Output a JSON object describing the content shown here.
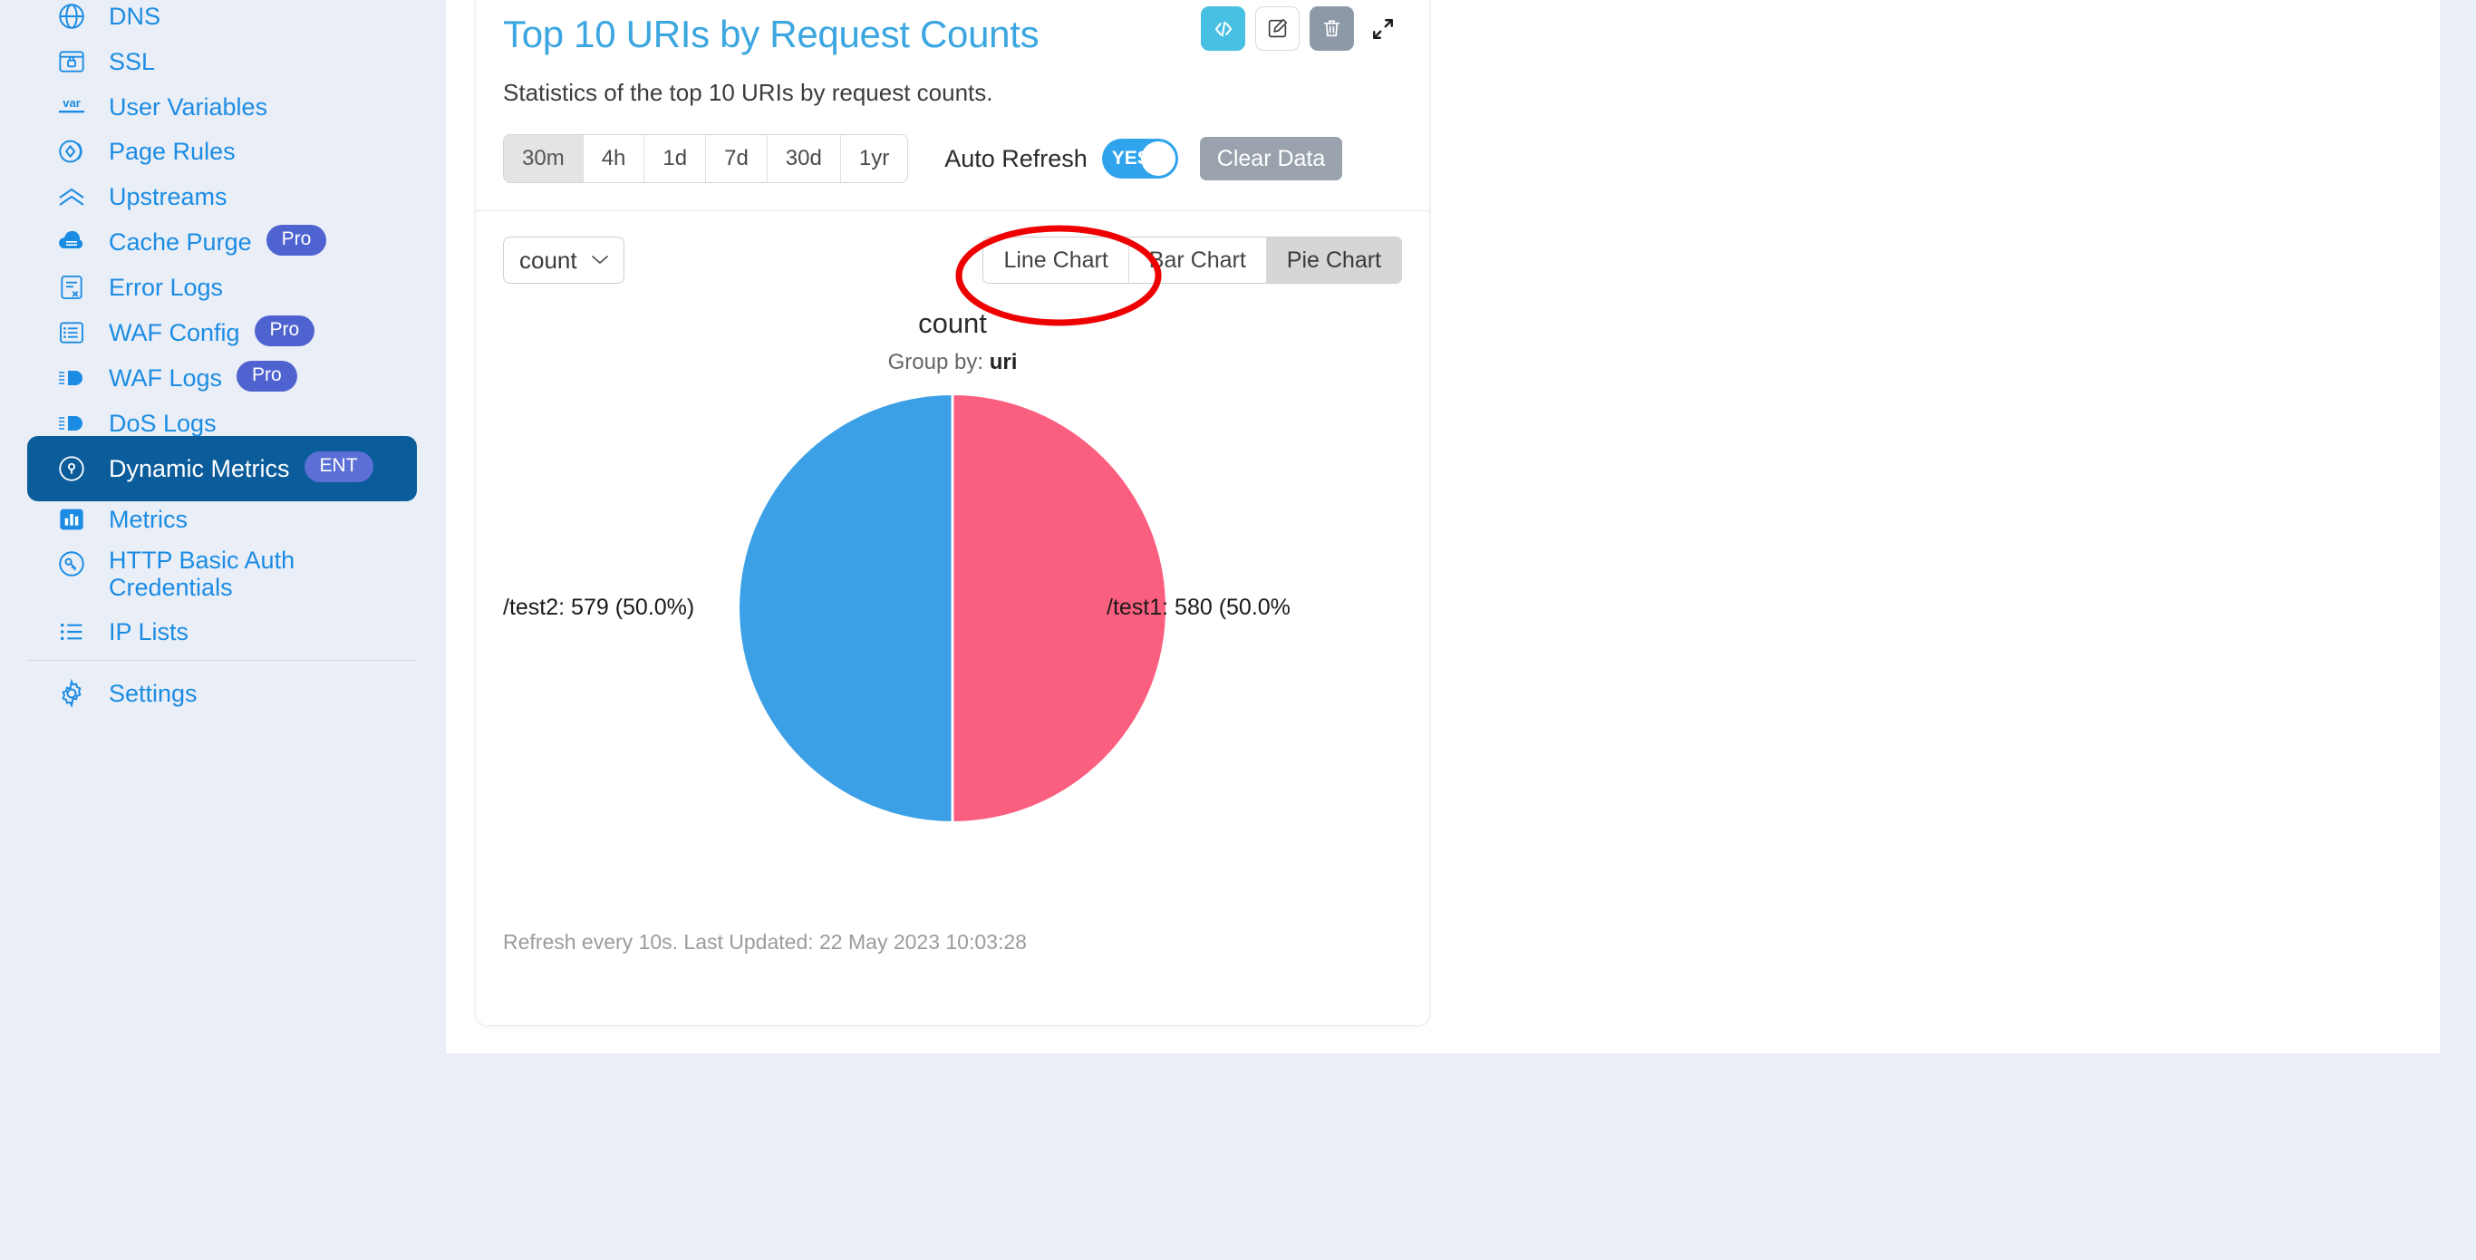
{
  "theme": {
    "accent_blue": "#1b8ce3",
    "active_nav_bg": "#0b5c9b",
    "badge_purple": "#4f63d0",
    "title_blue": "#3ba6e0",
    "annotation_red": "#ee0000",
    "pie_blue": "#3ba0e6",
    "pie_pink": "#fa5f7f"
  },
  "sidebar": {
    "items": [
      {
        "label": "DNS",
        "icon": "dns-globe-icon",
        "badge": null,
        "active": false
      },
      {
        "label": "SSL",
        "icon": "ssl-certificate-icon",
        "badge": null,
        "active": false
      },
      {
        "label": "User Variables",
        "icon": "var-icon",
        "badge": null,
        "active": false
      },
      {
        "label": "Page Rules",
        "icon": "page-rules-icon",
        "badge": null,
        "active": false
      },
      {
        "label": "Upstreams",
        "icon": "upstreams-chevron-icon",
        "badge": null,
        "active": false
      },
      {
        "label": "Cache Purge",
        "icon": "cache-purge-cloud-icon",
        "badge": "Pro",
        "active": false
      },
      {
        "label": "Error Logs",
        "icon": "error-logs-icon",
        "badge": null,
        "active": false
      },
      {
        "label": "WAF Config",
        "icon": "waf-config-list-icon",
        "badge": "Pro",
        "active": false
      },
      {
        "label": "WAF Logs",
        "icon": "waf-logs-icon",
        "badge": "Pro",
        "active": false
      },
      {
        "label": "DoS Logs",
        "icon": "dos-logs-icon",
        "badge": null,
        "active": false
      },
      {
        "label": "Dynamic Metrics",
        "icon": "dynamic-metrics-icon",
        "badge": "ENT",
        "active": true
      },
      {
        "label": "Metrics",
        "icon": "metrics-bar-icon",
        "badge": null,
        "active": false
      },
      {
        "label": "HTTP Basic Auth Credentials",
        "icon": "key-icon",
        "badge": null,
        "active": false
      },
      {
        "label": "IP Lists",
        "icon": "ip-lists-icon",
        "badge": null,
        "active": false
      },
      {
        "label": "Settings",
        "icon": "gear-icon",
        "badge": null,
        "active": false
      }
    ]
  },
  "card": {
    "title": "Top 10 URIs by Request Counts",
    "description": "Statistics of the top 10 URIs by request counts.",
    "actions": [
      {
        "name": "view-code-button",
        "icon": "code-icon",
        "glyph": "</>"
      },
      {
        "name": "edit-button",
        "icon": "pencil-square-icon",
        "glyph": "✎"
      },
      {
        "name": "delete-button",
        "icon": "trash-icon",
        "glyph": "🗑"
      },
      {
        "name": "expand-button",
        "icon": "expand-arrows-icon",
        "glyph": "↗"
      }
    ],
    "time_ranges": [
      {
        "label": "30m",
        "active": true
      },
      {
        "label": "4h",
        "active": false
      },
      {
        "label": "1d",
        "active": false
      },
      {
        "label": "7d",
        "active": false
      },
      {
        "label": "30d",
        "active": false
      },
      {
        "label": "1yr",
        "active": false
      }
    ],
    "auto_refresh_label": "Auto Refresh",
    "auto_refresh_value": "YES",
    "clear_data_label": "Clear Data",
    "metric_select_value": "count",
    "chart_types": [
      {
        "label": "Line Chart",
        "active": false
      },
      {
        "label": "Bar Chart",
        "active": false
      },
      {
        "label": "Pie Chart",
        "active": true
      }
    ],
    "footer": "Refresh every 10s. Last Updated: 22 May 2023 10:03:28"
  },
  "chart_data": {
    "type": "pie",
    "title": "count",
    "subtitle_prefix": "Group by:",
    "group_by": "uri",
    "categories": [
      "/test2",
      "/test1"
    ],
    "values": [
      579,
      580
    ],
    "percentages": [
      "50.0%",
      "50.0%"
    ],
    "labels": [
      {
        "text": "/test2: 579 (50.0%)",
        "color": "#3ba0e6",
        "side": "left"
      },
      {
        "text": "/test1: 580 (50.0%",
        "color": "#fa5f7f",
        "side": "right",
        "clipped": true
      }
    ],
    "legend": "none",
    "grid": false
  },
  "annotation": {
    "shape": "ellipse",
    "color": "#ee0000",
    "target": "Line Chart"
  }
}
